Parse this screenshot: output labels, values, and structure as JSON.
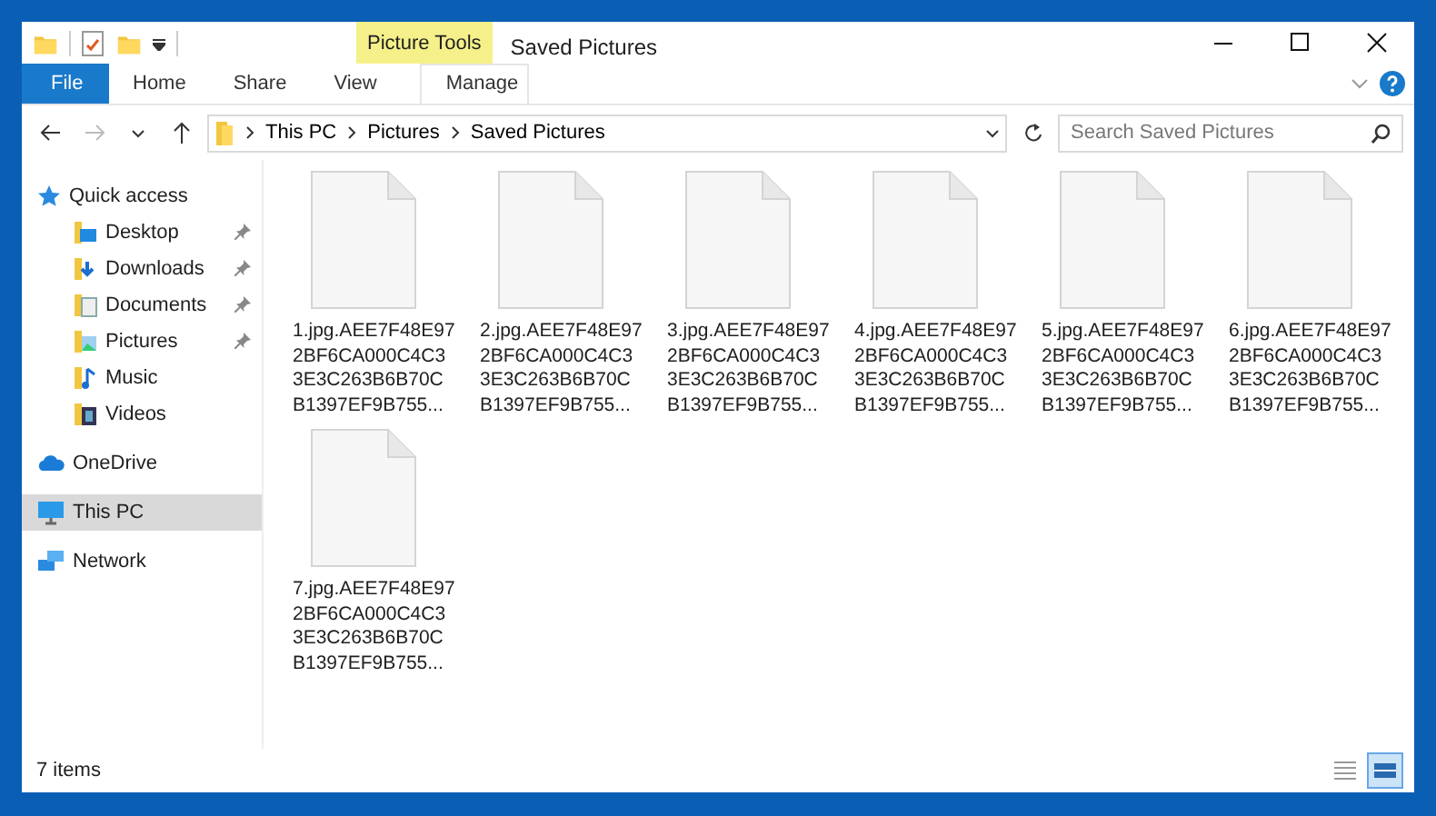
{
  "window": {
    "title": "Saved Pictures",
    "contextual_group": "Picture Tools"
  },
  "ribbon_tabs": [
    {
      "label": "File",
      "kind": "file",
      "selected": false
    },
    {
      "label": "Home",
      "kind": "tab",
      "selected": false
    },
    {
      "label": "Share",
      "kind": "tab",
      "selected": false
    },
    {
      "label": "View",
      "kind": "tab",
      "selected": false
    },
    {
      "label": "Manage",
      "kind": "contextual",
      "selected": false
    }
  ],
  "address": {
    "crumbs": [
      "This PC",
      "Pictures",
      "Saved Pictures"
    ]
  },
  "search": {
    "placeholder": "Search Saved Pictures"
  },
  "sidebar": {
    "items": [
      {
        "label": "Quick access",
        "kind": "star",
        "selected": false,
        "pinned": false,
        "children": [
          {
            "label": "Desktop",
            "kind": "desktop",
            "selected": false,
            "pinned": true
          },
          {
            "label": "Downloads",
            "kind": "downloads",
            "selected": false,
            "pinned": true
          },
          {
            "label": "Documents",
            "kind": "documents",
            "selected": false,
            "pinned": true
          },
          {
            "label": "Pictures",
            "kind": "pictures",
            "selected": false,
            "pinned": true
          },
          {
            "label": "Music",
            "kind": "music",
            "selected": false,
            "pinned": false
          },
          {
            "label": "Videos",
            "kind": "videos",
            "selected": false,
            "pinned": false
          }
        ]
      },
      {
        "label": "OneDrive",
        "kind": "cloud",
        "selected": false,
        "pinned": false
      },
      {
        "label": "This PC",
        "kind": "pc",
        "selected": true,
        "pinned": false
      },
      {
        "label": "Network",
        "kind": "network",
        "selected": false,
        "pinned": false
      }
    ]
  },
  "files": [
    {
      "lines": [
        "1.jpg.AEE7F48E97",
        "2BF6CA000C4C3",
        "3E3C263B6B70C",
        "B1397EF9B755..."
      ]
    },
    {
      "lines": [
        "2.jpg.AEE7F48E97",
        "2BF6CA000C4C3",
        "3E3C263B6B70C",
        "B1397EF9B755..."
      ]
    },
    {
      "lines": [
        "3.jpg.AEE7F48E97",
        "2BF6CA000C4C3",
        "3E3C263B6B70C",
        "B1397EF9B755..."
      ]
    },
    {
      "lines": [
        "4.jpg.AEE7F48E97",
        "2BF6CA000C4C3",
        "3E3C263B6B70C",
        "B1397EF9B755..."
      ]
    },
    {
      "lines": [
        "5.jpg.AEE7F48E97",
        "2BF6CA000C4C3",
        "3E3C263B6B70C",
        "B1397EF9B755..."
      ]
    },
    {
      "lines": [
        "6.jpg.AEE7F48E97",
        "2BF6CA000C4C3",
        "3E3C263B6B70C",
        "B1397EF9B755..."
      ]
    },
    {
      "lines": [
        "7.jpg.AEE7F48E97",
        "2BF6CA000C4C3",
        "3E3C263B6B70C",
        "B1397EF9B755..."
      ]
    }
  ],
  "status_bar": {
    "count": "7 items",
    "views": [
      {
        "kind": "details",
        "selected": false
      },
      {
        "kind": "large-icons",
        "selected": true
      }
    ]
  }
}
